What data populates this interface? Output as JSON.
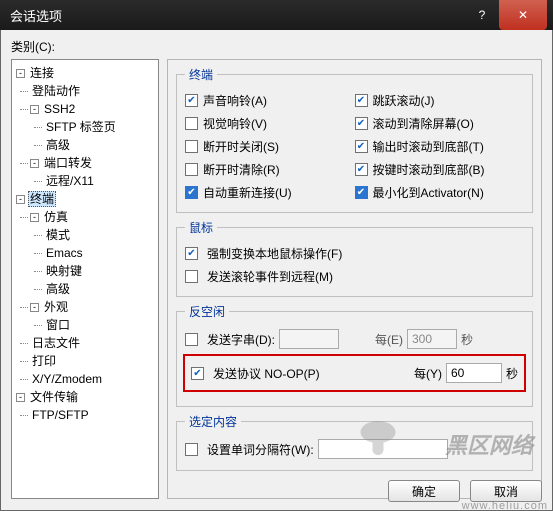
{
  "titlebar": {
    "title": "会话选项"
  },
  "category_label": "类别(C):",
  "tree": {
    "connection": "连接",
    "logon": "登陆动作",
    "ssh2": "SSH2",
    "sftp_tab": "SFTP 标签页",
    "advanced1": "高级",
    "port_fwd": "端口转发",
    "remote_x11": "远程/X11",
    "terminal": "终端",
    "emulation": "仿真",
    "modes": "模式",
    "emacs": "Emacs",
    "keymap": "映射键",
    "advanced2": "高级",
    "appearance": "外观",
    "window": "窗口",
    "logfile": "日志文件",
    "printing": "打印",
    "xyz": "X/Y/Zmodem",
    "file_transfer": "文件传输",
    "ftp_sftp": "FTP/SFTP"
  },
  "sections": {
    "terminal": "终端",
    "mouse": "鼠标",
    "anti_idle": "反空闲",
    "selection": "选定内容"
  },
  "opts": {
    "audio_bell": "声音响铃(A)",
    "jump_scroll": "跳跃滚动(J)",
    "visual_bell": "视觉响铃(V)",
    "clear_on_scroll": "滚动到清除屏幕(O)",
    "close_on_disc": "断开时关闭(S)",
    "scroll_bottom_out": "输出时滚动到底部(T)",
    "clear_on_disc": "断开时清除(R)",
    "scroll_bottom_key": "按键时滚动到底部(B)",
    "auto_reconnect": "自动重新连接(U)",
    "min_to_activator": "最小化到Activator(N)",
    "force_local_cursor": "强制变换本地鼠标操作(F)",
    "send_wheel_remote": "发送滚轮事件到远程(M)",
    "send_string": "发送字串(D):",
    "every_e": "每(E)",
    "sec1": "秒",
    "send_protocol": "发送协议 NO-OP(P)",
    "every_y": "每(Y)",
    "sec2": "秒",
    "word_delim": "设置单词分隔符(W):"
  },
  "values": {
    "idle_string": "",
    "idle_e": "300",
    "noop_y": "60",
    "word_delim": ""
  },
  "buttons": {
    "ok": "确定",
    "cancel": "取消"
  },
  "watermark": {
    "text": "黑区网络",
    "url": "www.heliu.com"
  }
}
